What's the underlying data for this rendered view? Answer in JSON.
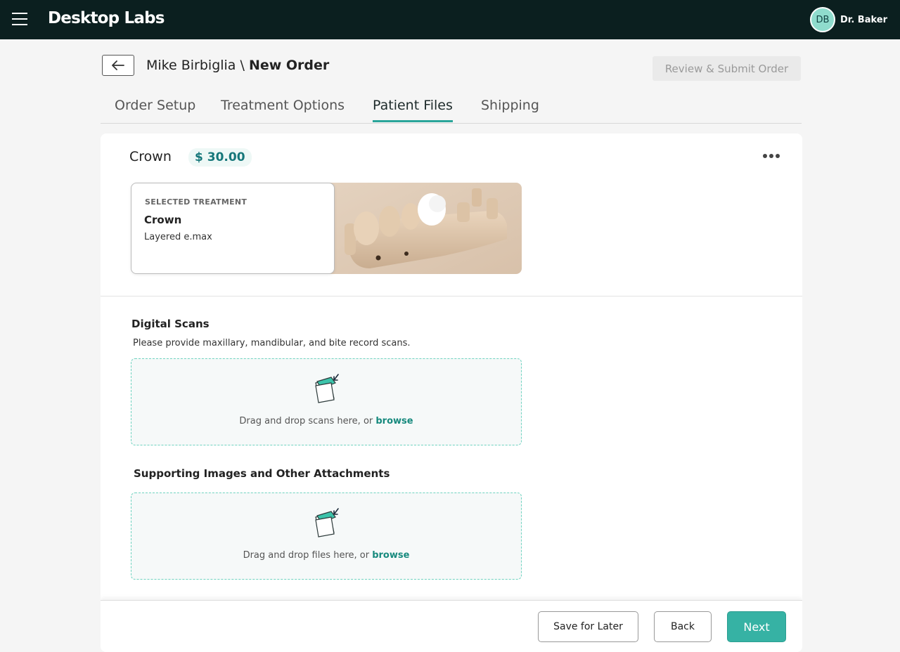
{
  "app": {
    "brand": "Desktop Labs",
    "user": {
      "initials": "DB",
      "name": "Dr. Baker"
    }
  },
  "header": {
    "patient": "Mike Birbiglia",
    "separator": " \\ ",
    "order": "New Order",
    "review_button": "Review & Submit Order"
  },
  "tabs": [
    {
      "label": "Order Setup",
      "active": false
    },
    {
      "label": "Treatment Options",
      "active": false
    },
    {
      "label": "Patient Files",
      "active": true
    },
    {
      "label": "Shipping",
      "active": false
    }
  ],
  "item": {
    "title": "Crown",
    "price": "$ 30.00",
    "treatment": {
      "label": "SELECTED TREATMENT",
      "name": "Crown",
      "material": "Layered e.max"
    }
  },
  "sections": {
    "digital_scans": {
      "title": "Digital Scans",
      "description": "Please provide maxillary, mandibular, and bite record scans.",
      "drop_text": "Drag and drop scans here, or ",
      "browse": "browse"
    },
    "attachments": {
      "title": "Supporting Images and Other Attachments",
      "drop_text": "Drag and drop files here, or ",
      "browse": "browse"
    }
  },
  "footer": {
    "save_label": "Save for Later",
    "back_label": "Back",
    "next_label": "Next"
  },
  "colors": {
    "topbar": "#0b1f1f",
    "accent": "#36b2a4",
    "tab_underline": "#2aa59a",
    "dropzone_border": "#6fd3c0"
  },
  "icons": {
    "menu": "hamburger-menu-icon",
    "back": "arrow-left-icon",
    "more": "more-horizontal-icon",
    "upload": "upload-folder-icon"
  }
}
